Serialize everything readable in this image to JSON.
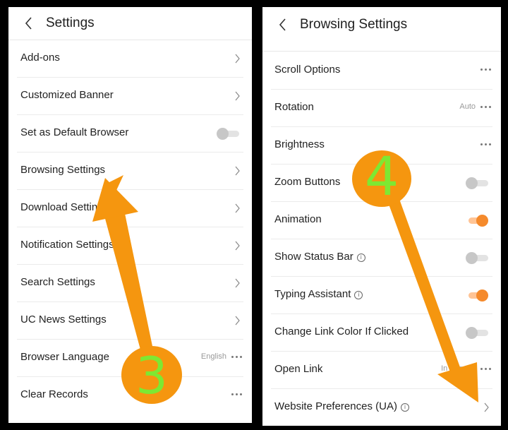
{
  "left": {
    "title": "Settings",
    "items": [
      {
        "label": "Add-ons",
        "control": "chevron"
      },
      {
        "label": "Customized Banner",
        "control": "chevron"
      },
      {
        "label": "Set as Default Browser",
        "control": "toggle",
        "on": false
      },
      {
        "label": "Browsing Settings",
        "control": "chevron"
      },
      {
        "label": "Download Settings",
        "control": "chevron"
      },
      {
        "label": "Notification Settings",
        "control": "chevron"
      },
      {
        "label": "Search Settings",
        "control": "chevron"
      },
      {
        "label": "UC News Settings",
        "control": "chevron"
      },
      {
        "label": "Browser Language",
        "control": "dots",
        "value": "English"
      },
      {
        "label": "Clear Records",
        "control": "dots"
      }
    ]
  },
  "right": {
    "title": "Browsing Settings",
    "items": [
      {
        "label": "Scroll Options",
        "control": "dots"
      },
      {
        "label": "Rotation",
        "control": "dots",
        "value": "Auto"
      },
      {
        "label": "Brightness",
        "control": "dots"
      },
      {
        "label": "Zoom Buttons",
        "control": "toggle",
        "on": false
      },
      {
        "label": "Animation",
        "control": "toggle",
        "on": true
      },
      {
        "label": "Show Status Bar",
        "control": "toggle",
        "on": false,
        "info": true
      },
      {
        "label": "Typing Assistant",
        "control": "toggle",
        "on": true,
        "info": true
      },
      {
        "label": "Change Link Color If Clicked",
        "control": "toggle",
        "on": false
      },
      {
        "label": "Open Link",
        "control": "dots",
        "value": "In Current"
      },
      {
        "label": "Website Preferences (UA)",
        "control": "chevron",
        "info": true
      }
    ]
  },
  "annotations": {
    "step3": "3",
    "step4": "4",
    "arrow_color": "#f5960f",
    "number_color": "#7ee832"
  },
  "colors": {
    "toggle_on": "#f58a2c",
    "toggle_off": "#c7c7c7"
  }
}
